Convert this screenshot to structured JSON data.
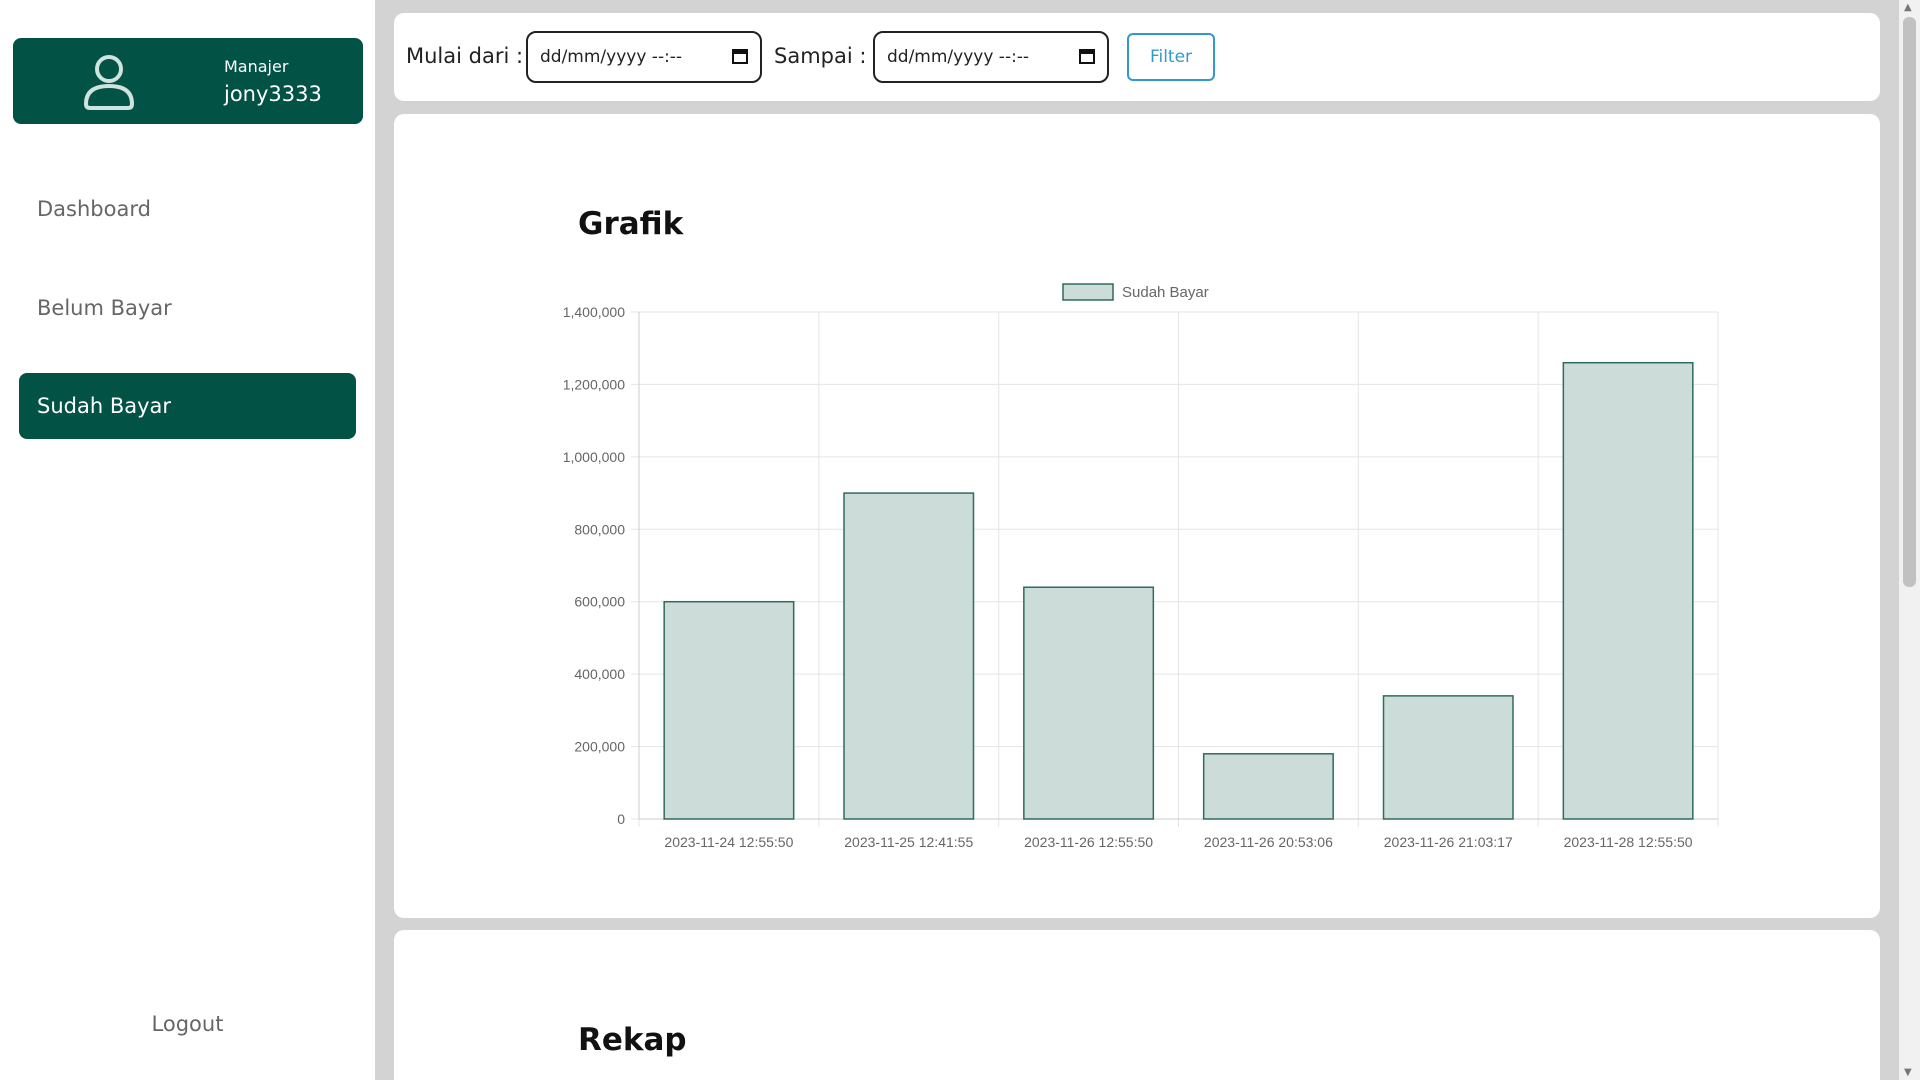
{
  "profile": {
    "role": "Manajer",
    "username": "jony3333"
  },
  "sidebar": {
    "items": [
      {
        "label": "Dashboard",
        "active": false
      },
      {
        "label": "Belum Bayar",
        "active": false
      },
      {
        "label": "Sudah Bayar",
        "active": true
      }
    ],
    "logout_label": "Logout"
  },
  "filter": {
    "from_label": "Mulai dari :",
    "from_placeholder": "dd/mm/yyyy --:--",
    "to_label": "Sampai :",
    "to_placeholder": "dd/mm/yyyy --:--",
    "button_label": "Filter"
  },
  "sections": {
    "chart_title": "Grafik",
    "rekap_title": "Rekap"
  },
  "colors": {
    "brand": "#025246",
    "bar_fill": "#ccdcd9",
    "bar_stroke": "#2f6b5f",
    "filter_accent": "#3399cc"
  },
  "chart_data": {
    "type": "bar",
    "categories": [
      "2023-11-24 12:55:50",
      "2023-11-25 12:41:55",
      "2023-11-26 12:55:50",
      "2023-11-26 20:53:06",
      "2023-11-26 21:03:17",
      "2023-11-28 12:55:50"
    ],
    "series": [
      {
        "name": "Sudah Bayar",
        "values": [
          600000,
          900000,
          640000,
          180000,
          340000,
          1260000
        ]
      }
    ],
    "ylim": [
      0,
      1400000
    ],
    "yticks": [
      "0",
      "200,000",
      "400,000",
      "600,000",
      "800,000",
      "1,000,000",
      "1,200,000",
      "1,400,000"
    ],
    "ytick_values": [
      0,
      200000,
      400000,
      600000,
      800000,
      1000000,
      1200000,
      1400000
    ],
    "grid": true,
    "legend": "top-center"
  }
}
